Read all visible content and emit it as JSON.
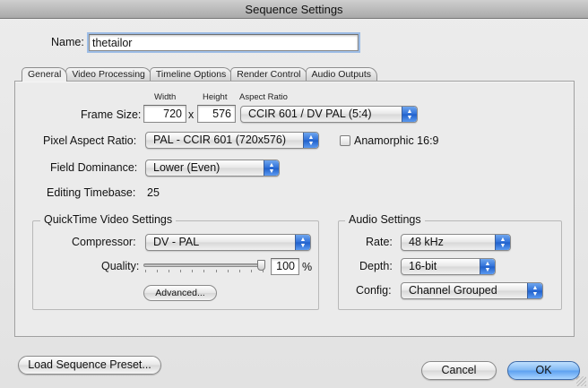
{
  "window": {
    "title": "Sequence Settings"
  },
  "name": {
    "label": "Name:",
    "value": "thetailor"
  },
  "tabs": [
    {
      "label": "General",
      "active": true
    },
    {
      "label": "Video Processing",
      "active": false
    },
    {
      "label": "Timeline Options",
      "active": false
    },
    {
      "label": "Render Control",
      "active": false
    },
    {
      "label": "Audio Outputs",
      "active": false
    }
  ],
  "general": {
    "col_width": "Width",
    "col_height": "Height",
    "col_aspect": "Aspect Ratio",
    "frame_size_label": "Frame Size:",
    "width": "720",
    "times": "x",
    "height": "576",
    "aspect_ratio": "CCIR 601 / DV PAL (5:4)",
    "pixel_aspect_label": "Pixel Aspect Ratio:",
    "pixel_aspect": "PAL - CCIR 601 (720x576)",
    "anamorphic_label": "Anamorphic 16:9",
    "anamorphic_checked": false,
    "field_dominance_label": "Field Dominance:",
    "field_dominance": "Lower (Even)",
    "timebase_label": "Editing Timebase:",
    "timebase": "25"
  },
  "quicktime": {
    "title": "QuickTime Video Settings",
    "compressor_label": "Compressor:",
    "compressor": "DV - PAL",
    "quality_label": "Quality:",
    "quality": "100",
    "quality_unit": "%",
    "quality_fraction": 1.0,
    "advanced_label": "Advanced..."
  },
  "audio": {
    "title": "Audio Settings",
    "rate_label": "Rate:",
    "rate": "48 kHz",
    "depth_label": "Depth:",
    "depth": "16-bit",
    "config_label": "Config:",
    "config": "Channel Grouped"
  },
  "footer": {
    "load_preset_label": "Load Sequence Preset...",
    "cancel_label": "Cancel",
    "ok_label": "OK"
  },
  "icons": {
    "popup": "up-down-arrows-icon",
    "resize": "resize-grip-icon"
  },
  "colors": {
    "accent": "#3a82ea",
    "focus": "#9dbde6"
  }
}
